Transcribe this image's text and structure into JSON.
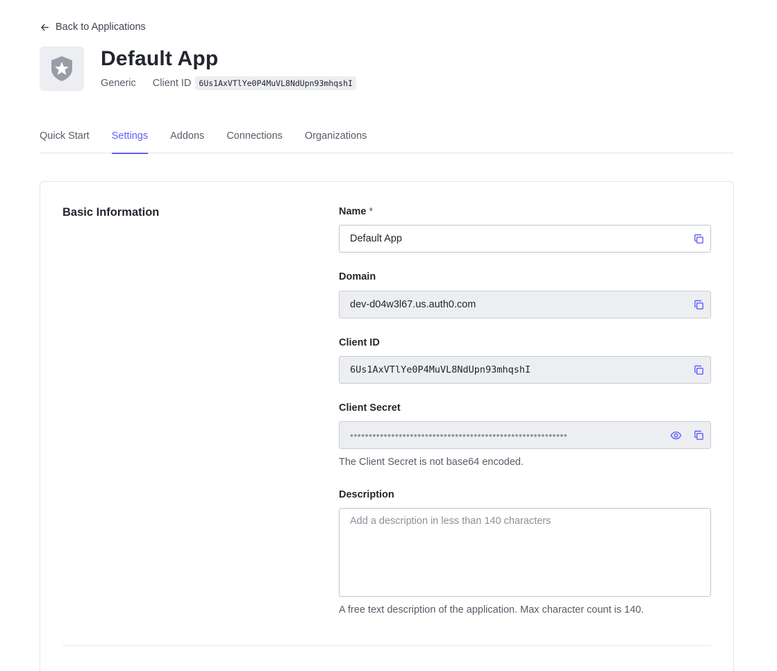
{
  "header": {
    "back_label": "Back to Applications",
    "app_name": "Default App",
    "app_type": "Generic",
    "client_id_label": "Client ID",
    "client_id": "6Us1AxVTlYe0P4MuVL8NdUpn93mhqshI"
  },
  "tabs": [
    {
      "label": "Quick Start",
      "active": false
    },
    {
      "label": "Settings",
      "active": true
    },
    {
      "label": "Addons",
      "active": false
    },
    {
      "label": "Connections",
      "active": false
    },
    {
      "label": "Organizations",
      "active": false
    }
  ],
  "basic_info": {
    "title": "Basic Information",
    "name": {
      "label": "Name",
      "required_mark": "*",
      "value": "Default App"
    },
    "domain": {
      "label": "Domain",
      "value": "dev-d04w3l67.us.auth0.com"
    },
    "client_id": {
      "label": "Client ID",
      "value": "6Us1AxVTlYe0P4MuVL8NdUpn93mhqshI"
    },
    "client_secret": {
      "label": "Client Secret",
      "masked_value": "••••••••••••••••••••••••••••••••••••••••••••••••••••••••••",
      "help": "The Client Secret is not base64 encoded."
    },
    "description": {
      "label": "Description",
      "placeholder": "Add a description in less than 140 characters",
      "value": "",
      "help": "A free text description of the application. Max character count is 140."
    }
  },
  "icons": {
    "back": "arrow-left-icon",
    "logo": "auth0-shield-star-icon",
    "copy": "copy-icon",
    "reveal": "eye-icon"
  },
  "colors": {
    "accent": "#635dff",
    "readonly_bg": "#eceef2",
    "border": "#e3e5ea"
  }
}
